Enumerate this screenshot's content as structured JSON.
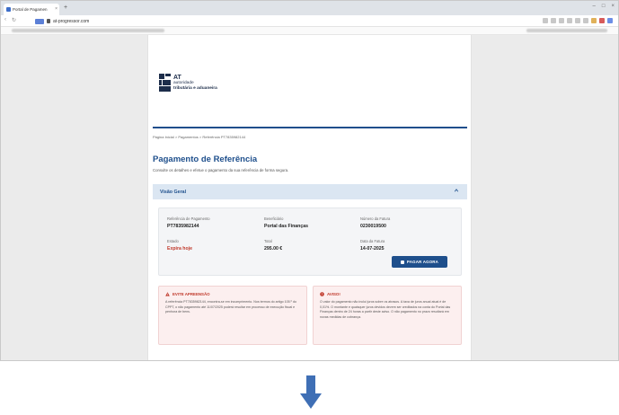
{
  "browser": {
    "tab_title": "Portal de Pagamen",
    "tab_close": "×",
    "new_tab": "+",
    "url": "at-progressor.com",
    "window_controls": [
      "–",
      "□",
      "×"
    ]
  },
  "logo": {
    "abbr": "AT",
    "line1": "autoridade",
    "line2": "tributária e aduaneira"
  },
  "breadcrumb": "Página Inicial  >  Pagamentos  >  Referência PT7835982144",
  "page": {
    "title": "Pagamento de Referência",
    "subtitle": "Consulte os detalhes e efetue o pagamento da sua referência de forma segura."
  },
  "accordion": {
    "title": "Visão Geral"
  },
  "details": {
    "ref_label": "Referência de Pagamento",
    "ref_value": "PT7835982144",
    "benef_label": "Beneficiário",
    "benef_value": "Portal das Finanças",
    "inv_label": "Número da Fatura",
    "inv_value": "0230019500",
    "status_label": "Estado",
    "status_value": "Expira hoje",
    "total_label": "Total",
    "total_value": "295.00 €",
    "date_label": "Data da Fatura",
    "date_value": "14-07-2025"
  },
  "pay_button": "PAGAR AGORA",
  "alert_left": {
    "title": "EVITE APREENSÃO",
    "body": "A referência PT7835982144, encontra-se em incumprimento. Nos termos do artigo 105.º do CPPT, o não pagamento até 11/07/2025 poderá resultar em processo de execução fiscal e penhora de bens."
  },
  "alert_right": {
    "title": "AVISO!",
    "body": "O valor do pagamento não inclui juros sobre os atrasos. A taxa de juros anual atual é de 0,01%. O montante e quaisquer juros devidos devem ser creditados na conta do Portal das Finanças dentro de 24 horas a partir deste aviso. O não pagamento no prazo resultará em novas medidas de cobrança."
  },
  "colors": {
    "brand_blue": "#1e4f8c",
    "alert_red": "#c0392b",
    "arrow_blue": "#3f6fb5"
  }
}
